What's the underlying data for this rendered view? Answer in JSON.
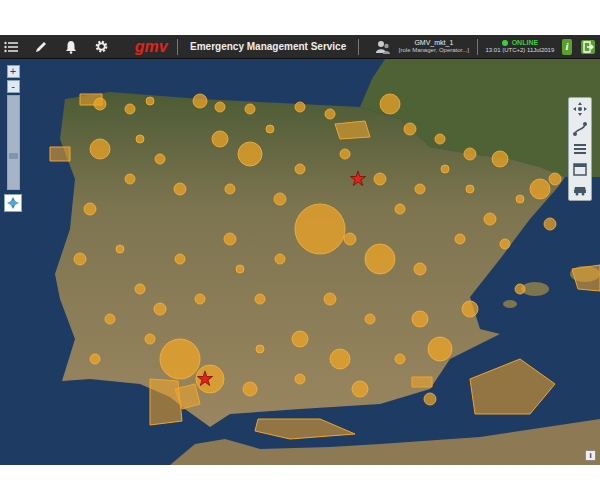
{
  "app": {
    "logo": "gmv",
    "title": "Emergency Management Service"
  },
  "user": {
    "name": "GMV_mkt_1",
    "role": "[role Manager, Operator...]"
  },
  "status": {
    "label": "ONLINE",
    "online": true,
    "time": "13:01 (UTC+2) 11Jul2019"
  },
  "header_buttons": {
    "info": "i"
  },
  "map_controls": {
    "zoom_in": "+",
    "zoom_out": "-",
    "zoom_level": 0.35
  },
  "corner_info": "i"
}
